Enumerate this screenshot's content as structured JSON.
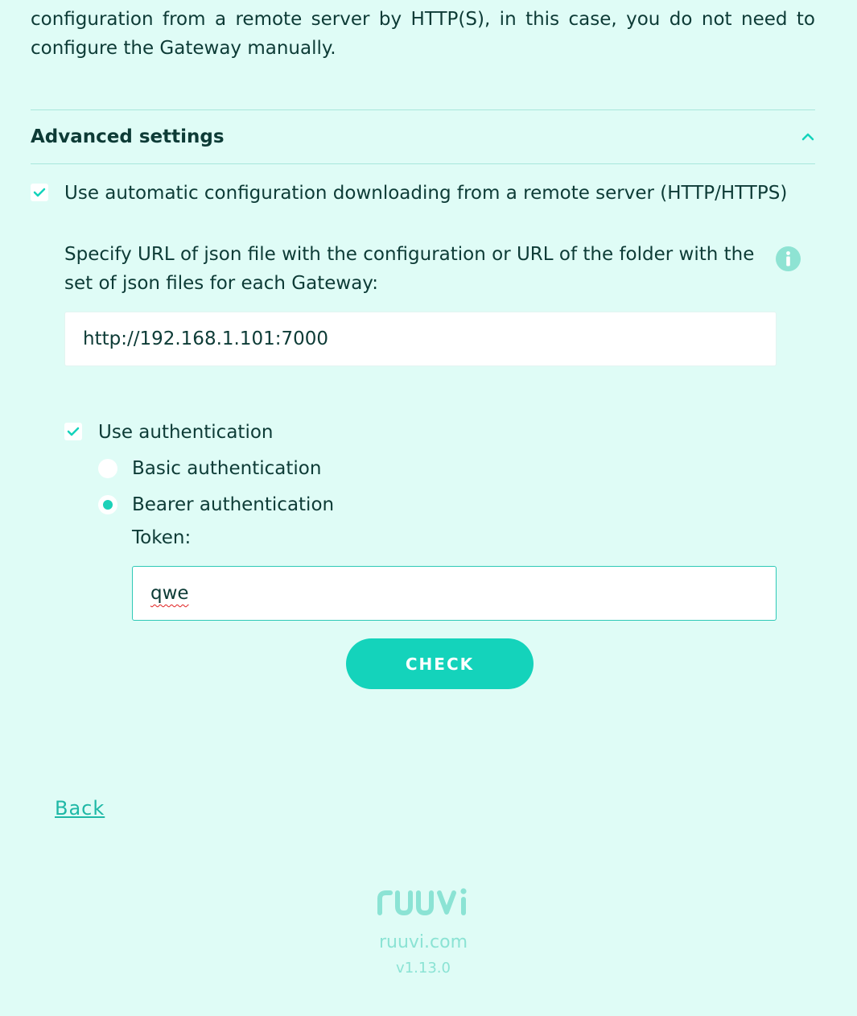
{
  "intro_text": "configuration from a remote server by HTTP(S), in this case, you do not need to configure the Gateway manually.",
  "advanced": {
    "title": "Advanced settings",
    "auto_config_label": "Use automatic configuration downloading from a remote server (HTTP/HTTPS)",
    "auto_config_checked": true,
    "specify_text": "Specify URL of json file with the configuration or URL of the folder with the set of json files for each Gateway:",
    "url_value": "http://192.168.1.101:7000",
    "use_auth_label": "Use authentication",
    "use_auth_checked": true,
    "auth_options": [
      {
        "label": "Basic authentication",
        "selected": false
      },
      {
        "label": "Bearer authentication",
        "selected": true
      }
    ],
    "token_label": "Token:",
    "token_value": "qwe",
    "check_button": "CHECK"
  },
  "back_label": "Back",
  "footer": {
    "logo_text": "ruuvi",
    "site": "ruuvi.com",
    "version": "v1.13.0"
  },
  "colors": {
    "background": "#dffcf6",
    "accent": "#14d3bb",
    "text": "#0d3b36",
    "muted": "#8be3d4"
  },
  "icons": {
    "expand": "chevron-up-icon",
    "check": "checkmark-icon",
    "info": "info-icon"
  }
}
